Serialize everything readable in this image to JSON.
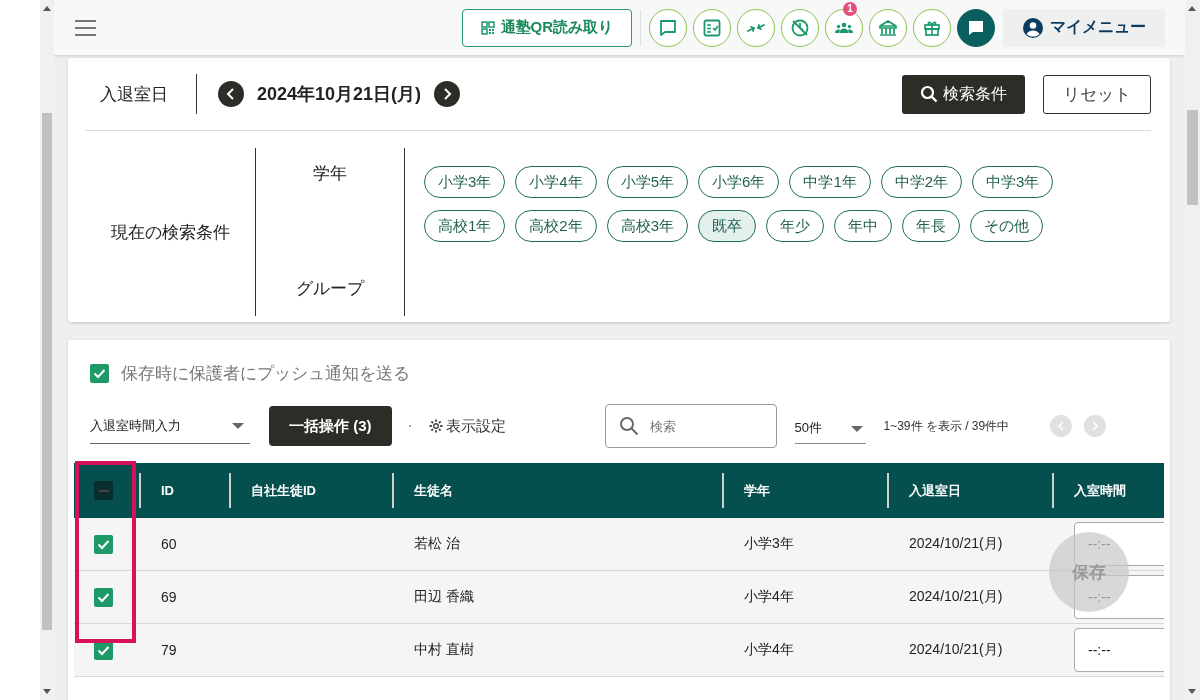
{
  "header": {
    "qr_button": "通塾QR読み取り",
    "icons": [
      {
        "kind": "chat"
      },
      {
        "kind": "checklist"
      },
      {
        "kind": "merge"
      },
      {
        "kind": "no-clock"
      },
      {
        "kind": "people",
        "badge": "1"
      },
      {
        "kind": "building"
      },
      {
        "kind": "gift"
      },
      {
        "kind": "chat-filled"
      }
    ],
    "my_menu": "マイメニュー"
  },
  "date_bar": {
    "label": "入退室日",
    "date": "2024年10月21日(月)",
    "search_button": "検索条件",
    "reset_button": "リセット"
  },
  "conditions": {
    "title": "現在の検索条件",
    "grade_label": "学年",
    "group_label": "グループ",
    "chips": [
      {
        "label": "小学3年",
        "selected": false
      },
      {
        "label": "小学4年",
        "selected": false
      },
      {
        "label": "小学5年",
        "selected": false
      },
      {
        "label": "小学6年",
        "selected": false
      },
      {
        "label": "中学1年",
        "selected": false
      },
      {
        "label": "中学2年",
        "selected": false
      },
      {
        "label": "中学3年",
        "selected": false
      },
      {
        "label": "高校1年",
        "selected": false
      },
      {
        "label": "高校2年",
        "selected": false
      },
      {
        "label": "高校3年",
        "selected": false
      },
      {
        "label": "既卒",
        "selected": true
      },
      {
        "label": "年少",
        "selected": false
      },
      {
        "label": "年中",
        "selected": false
      },
      {
        "label": "年長",
        "selected": false
      },
      {
        "label": "その他",
        "selected": false
      }
    ]
  },
  "notify": {
    "label": "保存時に保護者にプッシュ通知を送る",
    "checked": true
  },
  "toolbar": {
    "mode_select": "入退室時間入力",
    "bulk_button": "一括操作 (3)",
    "display_settings": "表示設定",
    "search_placeholder": "検索",
    "per_page": "50件",
    "range": "1~39件 を表示 / 39件中"
  },
  "table": {
    "select_all_indeterminate": true,
    "columns": [
      "ID",
      "自社生徒ID",
      "生徒名",
      "学年",
      "入退室日",
      "入室時間"
    ],
    "rows": [
      {
        "checked": true,
        "id": "60",
        "name": "若松 治",
        "grade": "小学3年",
        "date": "2024/10/21(月)",
        "entry_time": "--:--"
      },
      {
        "checked": true,
        "id": "69",
        "name": "田辺 香織",
        "grade": "小学4年",
        "date": "2024/10/21(月)",
        "entry_time": "--:--"
      },
      {
        "checked": true,
        "id": "79",
        "name": "中村 直樹",
        "grade": "小学4年",
        "date": "2024/10/21(月)",
        "entry_time": "--:--"
      }
    ]
  },
  "save_button": "保存"
}
